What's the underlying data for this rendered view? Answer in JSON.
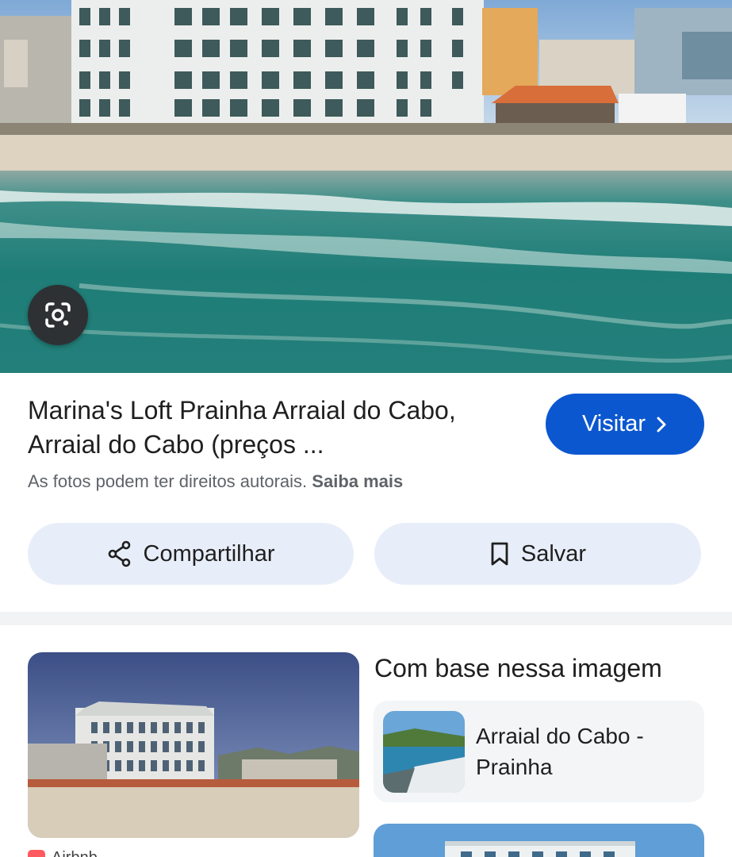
{
  "hero": {
    "image_description_icon": "beach-photo",
    "lens_icon": "google-lens-icon"
  },
  "result": {
    "title": "Marina's Loft Prainha Arraial do Cabo, Arraial do Cabo (preços ...",
    "visit_label": "Visitar",
    "copyright_text": "As fotos podem ter direitos autorais.",
    "learn_more": "Saiba mais"
  },
  "actions": {
    "share_label": "Compartilhar",
    "save_label": "Salvar"
  },
  "lower": {
    "source_label": "Airbnb",
    "based_on_title": "Com base nessa imagem",
    "related": [
      {
        "label": "Arraial do Cabo - Prainha"
      }
    ]
  },
  "colors": {
    "accent": "#0b57d0",
    "pill_bg": "#e8eef9",
    "card_bg": "#f3f5f7"
  }
}
